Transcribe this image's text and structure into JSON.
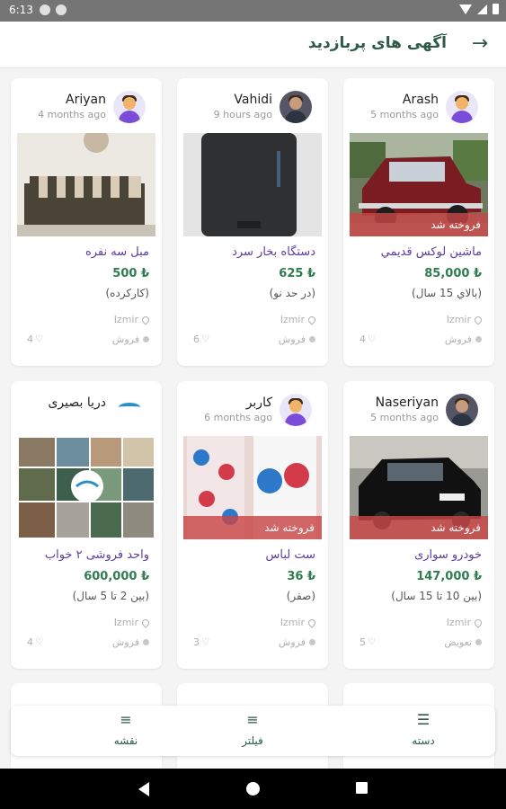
{
  "status_bar": {
    "time": "6:13"
  },
  "header": {
    "title": "آگهی های پربازدید"
  },
  "colors": {
    "accent": "#2c5a46",
    "title_purple": "#5b3c9b",
    "price_green": "#2e7d52",
    "sold_red": "#c84646"
  },
  "cards": [
    {
      "user": "Arash",
      "time": "5 months ago",
      "avatar": "avatar-icon",
      "title": "ماشين لوكس قديمي",
      "price": "85,000 ₺",
      "condition": "(بالاي 15 سال)",
      "location": "Izmir",
      "type": "فروش",
      "likes": "4",
      "sold": "فروخته شد"
    },
    {
      "user": "Vahidi",
      "time": "9 hours ago",
      "avatar": "photo-avatar",
      "title": "دستگاه بخار سرد",
      "price": "625 ₺",
      "condition": "(در حد نو)",
      "location": "Izmir",
      "type": "فروش",
      "likes": "6",
      "sold": ""
    },
    {
      "user": "Ariyan",
      "time": "4 months ago",
      "avatar": "avatar-icon",
      "title": "مبل سه نفره",
      "price": "500 ₺",
      "condition": "(كاركرده)",
      "location": "Izmir",
      "type": "فروش",
      "likes": "4",
      "sold": ""
    },
    {
      "user": "Naseriyan",
      "time": "5 months ago",
      "avatar": "photo-avatar",
      "title": "خودرو سواری",
      "price": "147,000 ₺",
      "condition": "(بین 10 تا 15 سال)",
      "location": "Izmir",
      "type": "تعویض",
      "likes": "5",
      "sold": "فروخته شد"
    },
    {
      "user": "کاربر",
      "time": "6 months ago",
      "avatar": "avatar-icon",
      "title": "ست لباس",
      "price": "36 ₺",
      "condition": "(صفر)",
      "location": "Izmir",
      "type": "فروش",
      "likes": "3",
      "sold": "فروخته شد"
    },
    {
      "user": "دریا بصیری",
      "time": "",
      "avatar": "logo",
      "title": "واحد فروشی ۲ خواب",
      "price": "600,000 ₺",
      "condition": "(بین 2 تا 5 سال)",
      "location": "Izmir",
      "type": "فروش",
      "likes": "4",
      "sold": ""
    }
  ],
  "bottom_nav": {
    "category": "دسته",
    "filter": "فیلتر",
    "map": "نقشه"
  }
}
